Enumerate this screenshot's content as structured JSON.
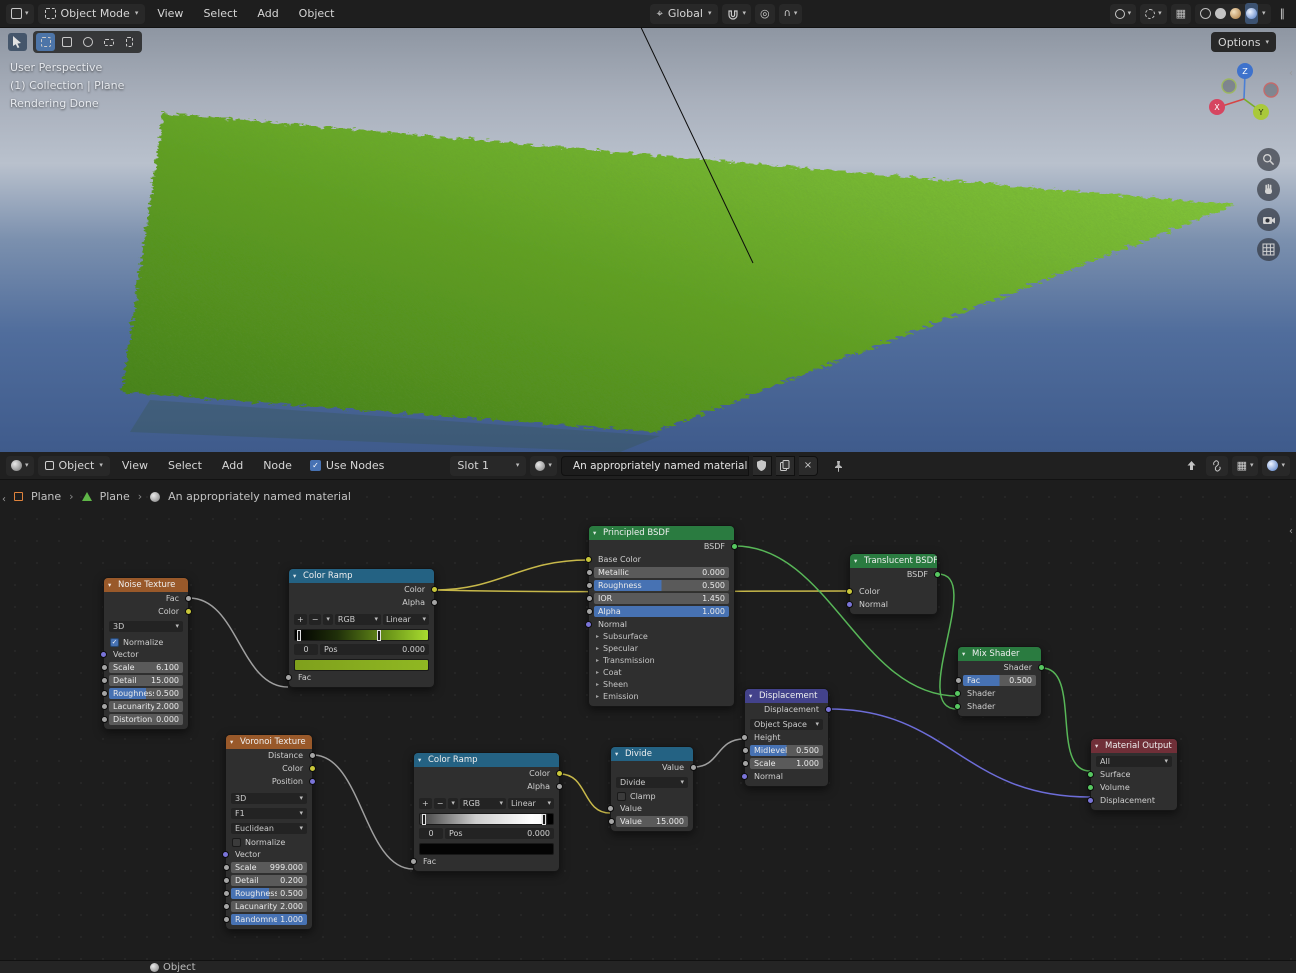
{
  "icons": {
    "caret": "▾",
    "chevron": "›",
    "back_chevron": "‹",
    "section_arrow": "▸",
    "check": "✓",
    "close": "×",
    "plus": "+",
    "minus": "−",
    "pause": "∥",
    "prop_circle": "◎",
    "falloff": "∩",
    "pivot": "⌖",
    "grid": "▦"
  },
  "topbar": {
    "mode_label": "Object Mode",
    "menus": [
      "View",
      "Select",
      "Add",
      "Object"
    ],
    "orientation_label": "Global",
    "options_label": "Options"
  },
  "viewport": {
    "overlay_lines": [
      "User Perspective",
      "(1) Collection | Plane",
      "Rendering Done"
    ],
    "axis_labels": {
      "x": "X",
      "y": "Y",
      "z": "Z"
    }
  },
  "shader_header": {
    "object_label": "Object",
    "menus": [
      "View",
      "Select",
      "Add",
      "Node"
    ],
    "use_nodes_label": "Use Nodes",
    "slot_label": "Slot 1",
    "material_name": "An appropriately named material"
  },
  "breadcrumb": {
    "items": [
      "Plane",
      "Plane",
      "An appropriately named material"
    ]
  },
  "statusbar": {
    "object_label": "Object"
  },
  "nodes": {
    "noise": {
      "title": "Noise Texture",
      "outputs": [
        "Fac",
        "Color"
      ],
      "dimensions": "3D",
      "normalize": "Normalize",
      "inputs": [
        "Vector"
      ],
      "params": [
        {
          "label": "Scale",
          "value": "6.100"
        },
        {
          "label": "Detail",
          "value": "15.000"
        },
        {
          "label": "Roughness",
          "value": "0.500"
        },
        {
          "label": "Lacunarity",
          "value": "2.000"
        },
        {
          "label": "Distortion",
          "value": "0.000"
        }
      ]
    },
    "ramp1": {
      "title": "Color Ramp",
      "outputs": [
        "Color",
        "Alpha"
      ],
      "color_mode": "RGB",
      "interpolation": "Linear",
      "index": "0",
      "pos_label": "Pos",
      "pos_value": "0.000",
      "input": "Fac"
    },
    "principled": {
      "title": "Principled BSDF",
      "output": "BSDF",
      "base_color_label": "Base Color",
      "normal_label": "Normal",
      "sliders": [
        {
          "label": "Metallic",
          "value": "0.000"
        },
        {
          "label": "Roughness",
          "value": "0.500"
        },
        {
          "label": "IOR",
          "value": "1.450"
        },
        {
          "label": "Alpha",
          "value": "1.000"
        }
      ],
      "sections": [
        "Subsurface",
        "Specular",
        "Transmission",
        "Coat",
        "Sheen",
        "Emission"
      ]
    },
    "translucent": {
      "title": "Translucent BSDF",
      "output": "BSDF",
      "inputs": [
        "Color",
        "Normal"
      ]
    },
    "mix": {
      "title": "Mix Shader",
      "output": "Shader",
      "fac": {
        "label": "Fac",
        "value": "0.500"
      },
      "inputs": [
        "Shader",
        "Shader"
      ]
    },
    "displacement": {
      "title": "Displacement",
      "output": "Displacement",
      "space": "Object Space",
      "height_label": "Height",
      "sliders": [
        {
          "label": "Midlevel",
          "value": "0.500"
        },
        {
          "label": "Scale",
          "value": "1.000"
        }
      ],
      "normal_label": "Normal"
    },
    "divide": {
      "title": "Divide",
      "output": "Value",
      "operation": "Divide",
      "clamp_label": "Clamp",
      "input_label": "Value",
      "value": {
        "label": "Value",
        "value": "15.000"
      }
    },
    "ramp2": {
      "title": "Color Ramp",
      "outputs": [
        "Color",
        "Alpha"
      ],
      "color_mode": "RGB",
      "interpolation": "Linear",
      "index": "0",
      "pos_label": "Pos",
      "pos_value": "0.000",
      "input": "Fac"
    },
    "voronoi": {
      "title": "Voronoi Texture",
      "outputs": [
        "Distance",
        "Color",
        "Position"
      ],
      "dimensions": "3D",
      "feature": "F1",
      "distance_metric": "Euclidean",
      "normalize": "Normalize",
      "inputs": [
        "Vector"
      ],
      "params": [
        {
          "label": "Scale",
          "value": "999.000"
        },
        {
          "label": "Detail",
          "value": "0.200"
        },
        {
          "label": "Roughness",
          "value": "0.500"
        },
        {
          "label": "Lacunarity",
          "value": "2.000"
        },
        {
          "label": "Randomness",
          "value": "1.000"
        }
      ]
    },
    "output": {
      "title": "Material Output",
      "target": "All",
      "inputs": [
        "Surface",
        "Volume",
        "Displacement"
      ]
    }
  }
}
